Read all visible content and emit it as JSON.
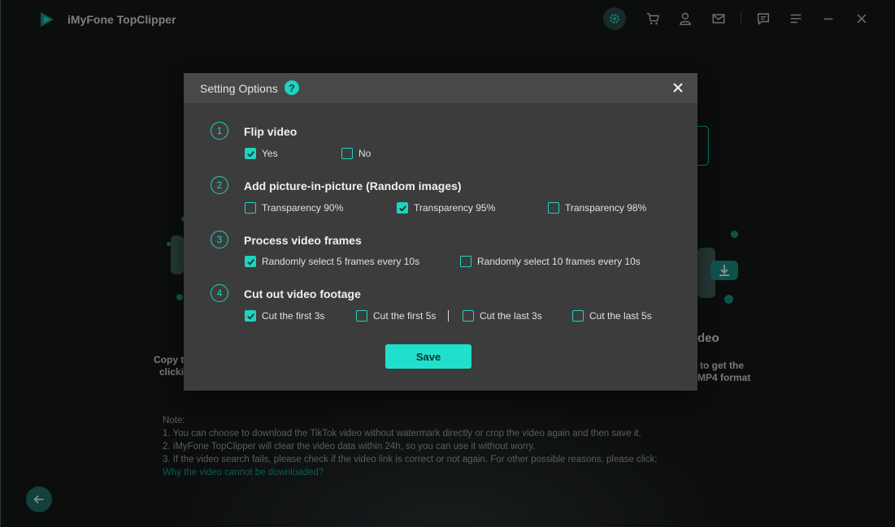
{
  "app": {
    "title": "iMyFone TopClipper"
  },
  "toolbar_icons": [
    "gear-icon",
    "cart-icon",
    "user-icon",
    "mail-icon",
    "chat-icon",
    "menu-icon",
    "minimize-icon",
    "close-icon"
  ],
  "background": {
    "copy_text_1": "Copy th",
    "copy_text_2": "clickin",
    "video_text": "deo",
    "get_text_1": "to get the",
    "get_text_2": "MP4 format",
    "notes": {
      "heading": "Note:",
      "line1": "1. You can choose to download the TikTok video without watermark directly or crop the video again and then save it.",
      "line2": "2. iMyFone TopClipper will clear the video data within 24h, so you can use it without worry.",
      "line3": "3. If the video search fails, please check if the video link is correct or not again. For other possible reasons, please click:",
      "link": "Why the video cannot be downloaded?"
    }
  },
  "dialog": {
    "title": "Setting Options",
    "help": "?",
    "save_label": "Save",
    "sections": [
      {
        "num": "1",
        "title": "Flip video",
        "options": [
          {
            "label": "Yes",
            "checked": true
          },
          {
            "label": "No",
            "checked": false
          }
        ]
      },
      {
        "num": "2",
        "title": "Add picture-in-picture (Random images)",
        "options": [
          {
            "label": "Transparency 90%",
            "checked": false
          },
          {
            "label": "Transparency 95%",
            "checked": true
          },
          {
            "label": "Transparency 98%",
            "checked": false
          }
        ]
      },
      {
        "num": "3",
        "title": "Process video frames",
        "options": [
          {
            "label": "Randomly select 5 frames every 10s",
            "checked": true
          },
          {
            "label": "Randomly select 10 frames every 10s",
            "checked": false
          }
        ]
      },
      {
        "num": "4",
        "title": "Cut out video footage",
        "options": [
          {
            "label": "Cut the first 3s",
            "checked": true
          },
          {
            "label": "Cut the first 5s",
            "checked": false
          },
          {
            "label": "Cut the last 3s",
            "checked": false
          },
          {
            "label": "Cut the last 5s",
            "checked": false
          }
        ]
      }
    ]
  },
  "colors": {
    "accent": "#1fd3bf",
    "dialog_bg": "#3c3c3c",
    "header_bg": "#484848"
  }
}
